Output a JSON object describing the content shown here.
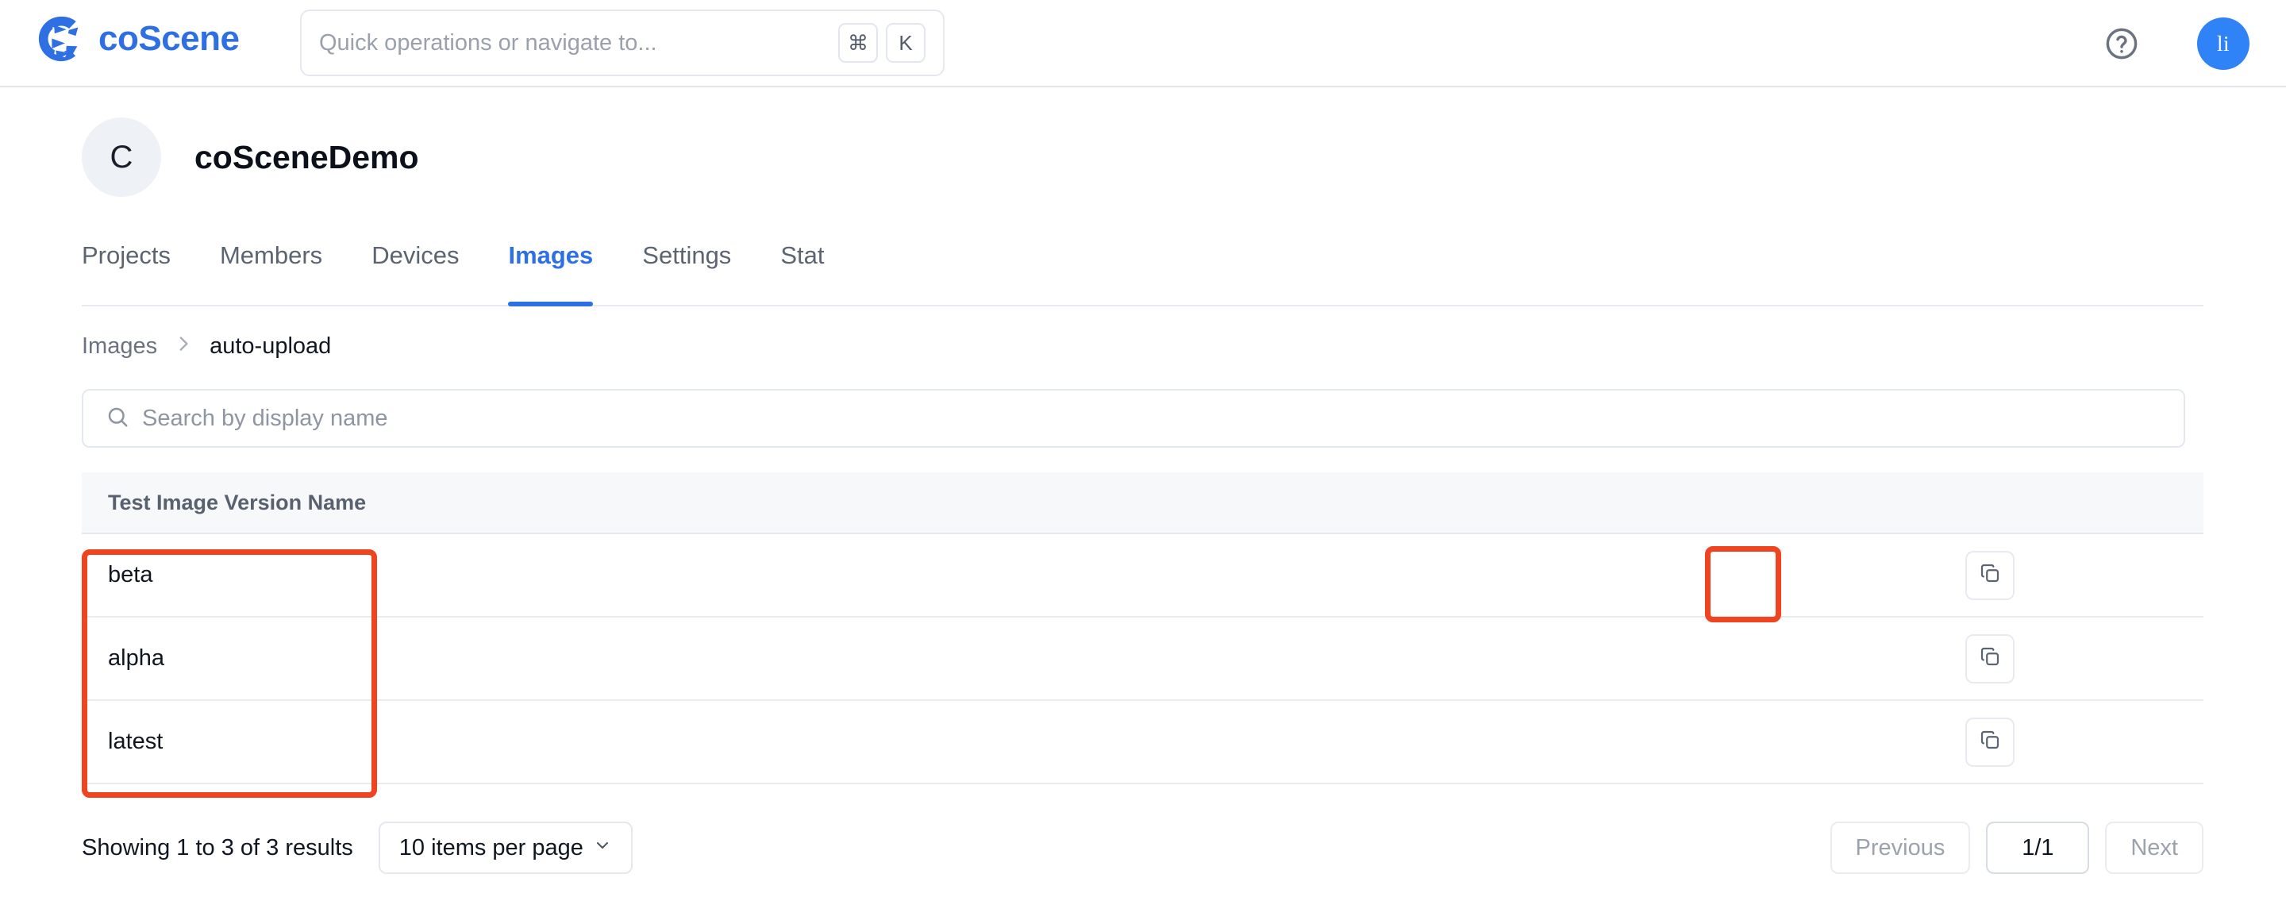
{
  "topbar": {
    "brand": "coScene",
    "brand_icon": "coscene-aperture-logo",
    "search_placeholder": "Quick operations or navigate to...",
    "shortcut_keys": [
      "⌘",
      "K"
    ],
    "help_icon": "help-circle-icon",
    "avatar_initials": "li",
    "brand_color": "#2f6fe4",
    "avatar_color": "#2f83f6"
  },
  "org": {
    "avatar_initial": "C",
    "name": "coSceneDemo"
  },
  "tabs": [
    {
      "label": "Projects",
      "active": false
    },
    {
      "label": "Members",
      "active": false
    },
    {
      "label": "Devices",
      "active": false
    },
    {
      "label": "Images",
      "active": true
    },
    {
      "label": "Settings",
      "active": false
    },
    {
      "label": "Stat",
      "active": false
    }
  ],
  "breadcrumb": {
    "root": "Images",
    "separator": "›",
    "current": "auto-upload"
  },
  "search": {
    "icon": "search-icon",
    "placeholder": "Search by display name",
    "value": ""
  },
  "table": {
    "columns": [
      "Test Image Version Name"
    ],
    "rows": [
      {
        "name": "beta",
        "action_icon": "copy-icon"
      },
      {
        "name": "alpha",
        "action_icon": "copy-icon"
      },
      {
        "name": "latest",
        "action_icon": "copy-icon"
      }
    ]
  },
  "annotations": {
    "highlight_color": "#f0431f",
    "boxes": [
      "version-name-column",
      "first-row-copy-button"
    ]
  },
  "footer": {
    "results_text": "Showing 1 to 3 of 3 results",
    "per_page_label": "10 items per page",
    "per_page_icon": "chevron-down-icon",
    "previous_label": "Previous",
    "page_indicator": "1/1",
    "next_label": "Next"
  }
}
